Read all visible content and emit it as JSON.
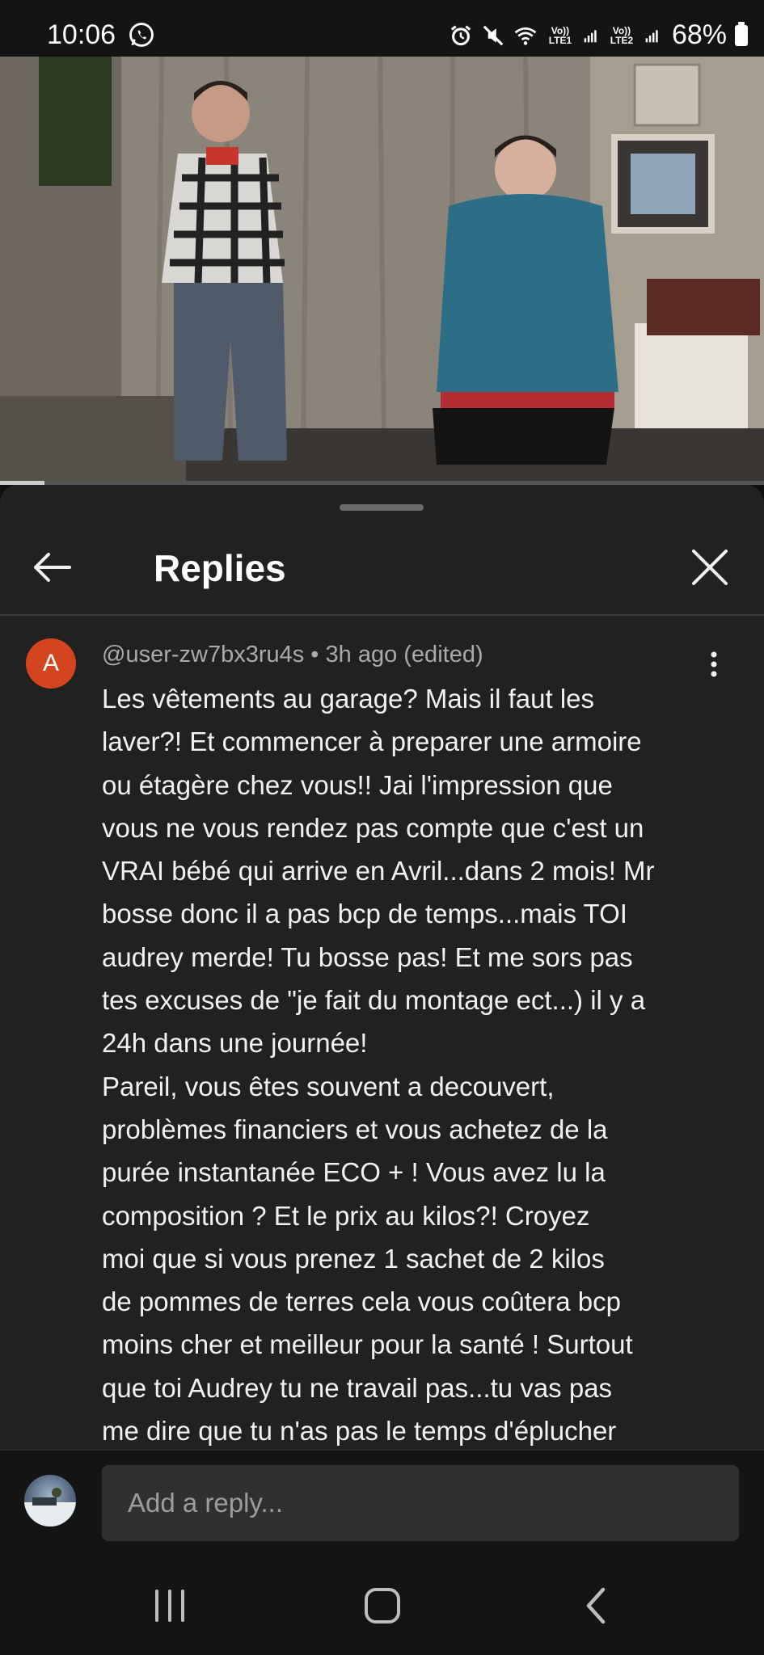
{
  "status_bar": {
    "time": "10:06",
    "whatsapp_icon": "whatsapp-icon",
    "icons": [
      "alarm-icon",
      "mute-icon",
      "wifi-icon"
    ],
    "network1": "Vo)) LTE1",
    "network2": "Vo)) LTE2",
    "battery": "68%"
  },
  "video": {
    "progress_fraction": 0.058
  },
  "sheet": {
    "title": "Replies",
    "back_icon": "arrow-left-icon",
    "close_icon": "close-icon"
  },
  "comment": {
    "avatar_letter": "A",
    "meta": "@user-zw7bx3ru4s • 3h ago (edited)",
    "lines": [
      "Les vêtements au garage? Mais il faut les",
      "laver?! Et commencer à preparer une armoire",
      "ou étagère chez vous!! Jai l'impression que",
      "vous ne vous rendez pas compte que c'est un",
      "VRAI bébé qui arrive en Avril...dans 2 mois! Mr",
      "bosse donc il a pas bcp de temps...mais TOI",
      "audrey merde! Tu bosse pas! Et me sors pas",
      "tes excuses de \"je fait du montage ect...) il y a",
      "24h dans une journée!",
      "Pareil, vous êtes souvent a decouvert,",
      "problèmes financiers et vous achetez de la",
      "purée instantanée ECO + ! Vous avez lu la",
      "composition ? Et le prix au kilos?! Croyez",
      "moi que si vous prenez 1 sachet de 2 kilos",
      "de pommes de terres cela vous coûtera bcp",
      "moins cher et meilleur pour la santé ! Surtout",
      "que toi Audrey tu ne travail pas...tu vas pas",
      "me dire que tu n'as pas le temps d'éplucher"
    ]
  },
  "composer": {
    "placeholder": "Add a reply..."
  },
  "nav": {
    "recents_icon": "recents-icon",
    "home_icon": "home-icon",
    "back_icon": "back-chevron-icon"
  }
}
